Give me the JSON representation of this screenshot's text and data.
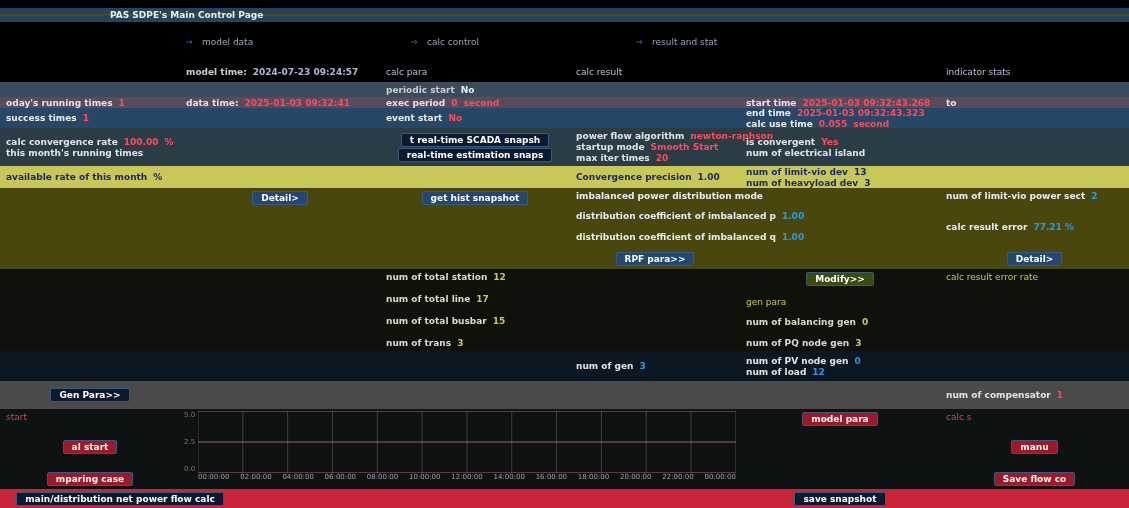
{
  "title": "PAS SDPE's Main Control Page",
  "nav": [
    {
      "label": "model data"
    },
    {
      "label": "calc control"
    },
    {
      "label": "result and stat"
    }
  ],
  "bands": [
    {
      "columns": [
        [],
        [
          {
            "kind": "pair",
            "label": "model time:",
            "value": "2024-07-23 09:24:57"
          }
        ],
        [
          {
            "kind": "heading",
            "text": "calc para"
          }
        ],
        [
          {
            "kind": "heading",
            "text": "calc result"
          }
        ],
        [],
        [
          {
            "kind": "heading",
            "text": "indicator stats"
          }
        ]
      ]
    },
    {
      "columns": [
        [],
        [],
        [
          {
            "kind": "pair",
            "label": "periodic start",
            "value": "No"
          }
        ],
        [],
        [],
        []
      ]
    },
    {
      "columns": [
        [
          {
            "kind": "pair",
            "label": "oday's running times",
            "value": "1"
          }
        ],
        [
          {
            "kind": "pair",
            "label": "data time:",
            "value": "2025-01-03 09:32:41"
          }
        ],
        [
          {
            "kind": "pair",
            "label": "exec period",
            "value": "0",
            "unit": "second"
          }
        ],
        [],
        [
          {
            "kind": "pair",
            "label": "start time",
            "value": "2025-01-03 09:32:43.268"
          }
        ],
        [
          {
            "kind": "text",
            "text": "to"
          }
        ]
      ]
    },
    {
      "columns": [
        [
          {
            "kind": "pair",
            "label": "success times",
            "value": "1"
          }
        ],
        [],
        [
          {
            "kind": "pair",
            "label": "event start",
            "value": "No"
          }
        ],
        [],
        [
          {
            "kind": "pair",
            "label": "end time",
            "value": "2025-01-03 09:32:43.323"
          },
          {
            "kind": "pair",
            "label": "calc use time",
            "value": "0.055",
            "unit": "second"
          }
        ],
        []
      ]
    },
    {
      "columns": [
        [
          {
            "kind": "pair",
            "label": "calc convergence rate",
            "value": "100.00",
            "unit": "%"
          },
          {
            "kind": "text",
            "text": "this month's running times"
          }
        ],
        [],
        [
          {
            "kind": "button",
            "text": "t real-time SCADA snapsh"
          },
          {
            "kind": "button",
            "text": "real-time estimation snaps"
          }
        ],
        [
          {
            "kind": "pair",
            "label": "power flow algorithm",
            "value": "newton-raphson"
          },
          {
            "kind": "pair",
            "label": "startup mode",
            "value": "Smooth Start"
          },
          {
            "kind": "pair",
            "label": "max iter times",
            "value": "20"
          }
        ],
        [
          {
            "kind": "pair",
            "label": "is convergent",
            "value": "Yes"
          },
          {
            "kind": "text",
            "text": "num of electrical island"
          }
        ],
        []
      ]
    },
    {
      "columns": [
        [
          {
            "kind": "pair",
            "label": "available rate of this month",
            "unit": "%"
          }
        ],
        [],
        [],
        [
          {
            "kind": "pair",
            "label": "Convergence precision",
            "value": "1.00"
          }
        ],
        [
          {
            "kind": "pair",
            "label": "num of limit-vio dev",
            "value": "13"
          },
          {
            "kind": "pair",
            "label": "num of heavyload dev",
            "value": "3"
          }
        ],
        []
      ]
    },
    {
      "columns": [
        [],
        [
          {
            "kind": "button",
            "text": "Detail>"
          }
        ],
        [
          {
            "kind": "button",
            "text": "get hist snapshot"
          }
        ],
        [
          {
            "kind": "text",
            "text": "imbalanced power distribution mode"
          },
          {
            "kind": "pair",
            "label": "distribution coefficient of imbalanced p",
            "value": "1.00"
          },
          {
            "kind": "pair",
            "label": "distribution coefficient of imbalanced q",
            "value": "1.00"
          },
          {
            "kind": "button",
            "text": "RPF para>>"
          }
        ],
        [],
        [
          {
            "kind": "pair",
            "label": "num of limit-vio power sect",
            "value": "2"
          },
          {
            "kind": "pair",
            "label": "calc result error",
            "value": "77.21 %"
          },
          {
            "kind": "button",
            "text": "Detail>"
          }
        ]
      ]
    },
    {
      "columns": [
        [],
        [],
        [
          {
            "kind": "pair",
            "label": "num of total station",
            "value": "12"
          },
          {
            "kind": "pair",
            "label": "num of total line",
            "value": "17"
          },
          {
            "kind": "pair",
            "label": "num of total busbar",
            "value": "15"
          },
          {
            "kind": "pair",
            "label": "num of trans",
            "value": "3"
          }
        ],
        [],
        [
          {
            "kind": "button",
            "text": "Modify>>"
          },
          {
            "kind": "heading",
            "text": "gen para"
          },
          {
            "kind": "pair",
            "label": "num of balancing gen",
            "value": "0"
          },
          {
            "kind": "pair",
            "label": "num of PQ node gen",
            "value": "3"
          }
        ],
        [
          {
            "kind": "heading",
            "text": "calc result error rate"
          }
        ]
      ]
    },
    {
      "columns": [
        [],
        [],
        [],
        [
          {
            "kind": "pair",
            "label": "num of gen",
            "value": "3"
          }
        ],
        [
          {
            "kind": "pair",
            "label": "num of PV node gen",
            "value": "0"
          },
          {
            "kind": "pair",
            "label": "num of load",
            "value": "12"
          }
        ],
        []
      ]
    },
    {
      "columns": [
        [
          {
            "kind": "button",
            "text": "Gen Para>>"
          }
        ],
        [],
        [],
        [],
        [],
        [
          {
            "kind": "pair",
            "label": "num of compensator",
            "value": "1"
          }
        ]
      ]
    },
    {
      "columns": [
        [
          {
            "kind": "heading",
            "text": "start"
          },
          {
            "kind": "button",
            "text": "al start"
          },
          {
            "kind": "button",
            "text": "mparing case"
          }
        ],
        [
          {
            "kind": "chart",
            "y_labels": [
              "5.0",
              "2.5",
              "0.0"
            ],
            "x_labels": [
              "00:00:00",
              "02:00:00",
              "04:00:00",
              "06:00:00",
              "08:00:00",
              "10:00:00",
              "12:00:00",
              "14:00:00",
              "16:00:00",
              "18:00:00",
              "20:00:00",
              "22:00:00",
              "00:00:00"
            ]
          }
        ],
        [],
        [],
        [
          {
            "kind": "button",
            "text": "model para"
          }
        ],
        [
          {
            "kind": "heading",
            "text": "calc s"
          },
          {
            "kind": "button",
            "text": "manu"
          },
          {
            "kind": "button",
            "text": "Save flow co"
          }
        ]
      ]
    },
    {
      "columns": [
        [
          {
            "kind": "button",
            "text": "main/distribution net power flow calc"
          }
        ],
        [],
        [],
        [],
        [
          {
            "kind": "button",
            "text": "save snapshot"
          }
        ],
        []
      ]
    }
  ]
}
